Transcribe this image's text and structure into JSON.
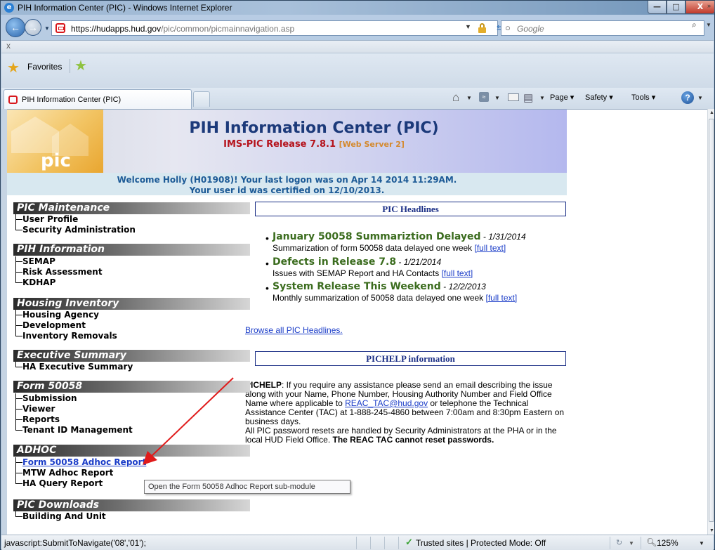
{
  "window": {
    "title": "PIH Information Center (PIC) - Windows Internet Explorer",
    "min_label": "—",
    "max_label": "□",
    "close_label": "X"
  },
  "address": {
    "url_host": "https://hudapps.hud.gov",
    "url_path": "/pic/common/picmainnavigation.asp"
  },
  "search": {
    "placeholder": "Google"
  },
  "favorites": {
    "label": "Favorites"
  },
  "tabs": [
    {
      "label": "PIH Information Center (PIC)"
    }
  ],
  "command_bar": {
    "page_label": "Page",
    "safety_label": "Safety",
    "tools_label": "Tools"
  },
  "header": {
    "logo_text": "pic",
    "title": "PIH Information Center (PIC)",
    "release": "IMS-PIC Release 7.8.1",
    "server": "[Web Server 2]",
    "welcome_line1": "Welcome Holly (H01908)! Your last logon was on Apr 14 2014 11:29AM.",
    "welcome_line2": "Your user id was certified on 12/10/2013."
  },
  "nav": {
    "sections": [
      {
        "title": "PIC Maintenance",
        "items": [
          "User Profile",
          "Security Administration"
        ]
      },
      {
        "title": "PIH Information",
        "items": [
          "SEMAP",
          "Risk Assessment",
          "KDHAP"
        ]
      },
      {
        "title": "Housing Inventory",
        "items": [
          "Housing Agency",
          "Development",
          "Inventory Removals"
        ]
      },
      {
        "title": "Executive Summary",
        "items": [
          "HA Executive Summary"
        ]
      },
      {
        "title": "Form 50058",
        "items": [
          "Submission",
          "Viewer",
          "Reports",
          "Tenant ID Management"
        ]
      },
      {
        "title": "ADHOC",
        "items": [
          "Form 50058 Adhoc Report",
          "MTW Adhoc Report",
          "HA Query Report"
        ]
      },
      {
        "title": "PIC Downloads",
        "items": [
          "Building And Unit"
        ]
      }
    ]
  },
  "headlines": {
    "heading": "PIC Headlines",
    "items": [
      {
        "title": "January 50058 Summariztion Delayed",
        "date": " - 1/31/2014",
        "desc": "Summarization of form 50058 data delayed one week ",
        "link": "[full text]"
      },
      {
        "title": "Defects in Release 7.8",
        "date": " - 1/21/2014",
        "desc": "Issues with SEMAP Report and HA Contacts ",
        "link": "[full text]"
      },
      {
        "title": "System Release This Weekend",
        "date": " - 12/2/2013",
        "desc": "Monthly summarization of 50058 data delayed one week ",
        "link": "[full text]"
      }
    ],
    "browse_all": "Browse all PIC Headlines."
  },
  "pichelp": {
    "heading": "PICHELP information",
    "lead": "PICHELP",
    "text1": ": If you require any assistance please send an email describing the issue along with your Name, Phone Number, Housing Authority Number and Field Office Name where applicable to ",
    "email": "REAC_TAC@hud.gov",
    "text2": " or telephone the Technical Assistance Center (TAC) at 1-888-245-4860 between 7:00am and 8:30pm Eastern on business days.",
    "text3": "All PIC password resets are handled by Security Administrators at the PHA or in the local HUD Field Office. ",
    "bold_end": "The REAC TAC cannot reset passwords."
  },
  "tooltip": "Open the Form 50058 Adhoc Report sub-module",
  "status": {
    "text": "javascript:SubmitToNavigate('08','01');",
    "zone": "Trusted sites | Protected Mode: Off",
    "zoom": "125%"
  },
  "colors": {
    "link": "#1a3cc8",
    "headline_green": "#3b6c1e",
    "panel_border": "#1b2f86",
    "annotation_arrow": "#e01b1b"
  }
}
